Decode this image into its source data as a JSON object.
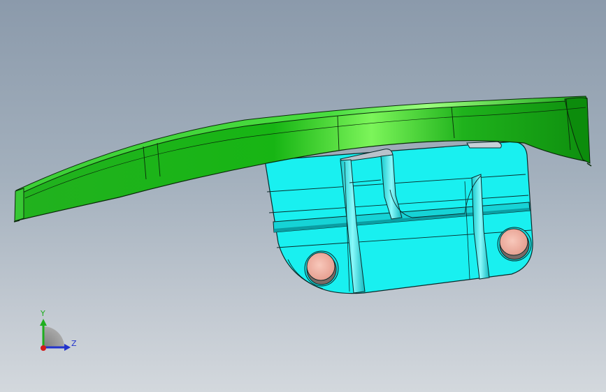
{
  "viewport": {
    "background_top": "#8b9aab",
    "background_bottom": "#d3d8dd"
  },
  "model": {
    "cover_color": "#1fba1f",
    "bracket_color": "#19f0f0",
    "pad_color": "#f2b6a8",
    "edge_color": "#0a2a0a"
  },
  "triad": {
    "y_label": "Y",
    "z_label": "Z",
    "y_color": "#1fae1f",
    "z_color": "#2233cc",
    "x_color": "#d41a1a"
  }
}
